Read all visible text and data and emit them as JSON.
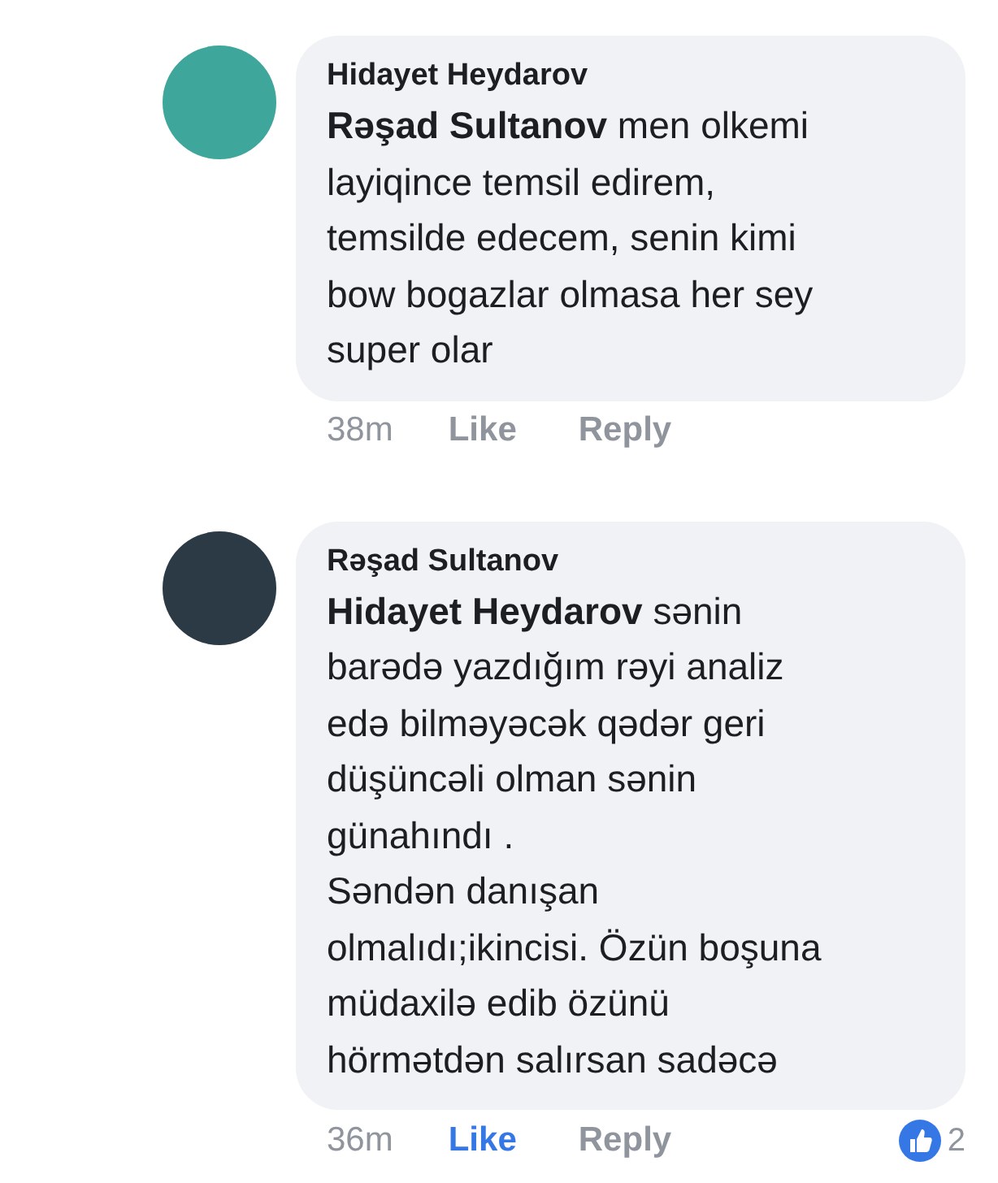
{
  "comments": [
    {
      "author": "Hidayet Heydarov",
      "body": "**Rəşad Sultanov** men olkemi\nlayiqince temsil edirem,\ntemsilde edecem, senin kimi\nbow bogazlar olmasa her sey\nsuper olar",
      "time": "38m",
      "like": "Like",
      "liked": false,
      "reply": "Reply"
    },
    {
      "author": "Rəşad Sultanov",
      "body": "**Hidayet Heydarov** sənin\nbarədə yazdığım rəyi analiz\nedə bilməyəcək qədər geri\ndüşüncəli olman sənin\ngünahındı .\nSəndən danışan\nolmalıdı;ikincisi. Özün boşuna\nmüdaxilə edib özünü\nhörmətdən salırsan sadəcə",
      "time": "36m",
      "like": "Like",
      "liked": true,
      "reply": "Reply",
      "reactions": "2"
    }
  ]
}
